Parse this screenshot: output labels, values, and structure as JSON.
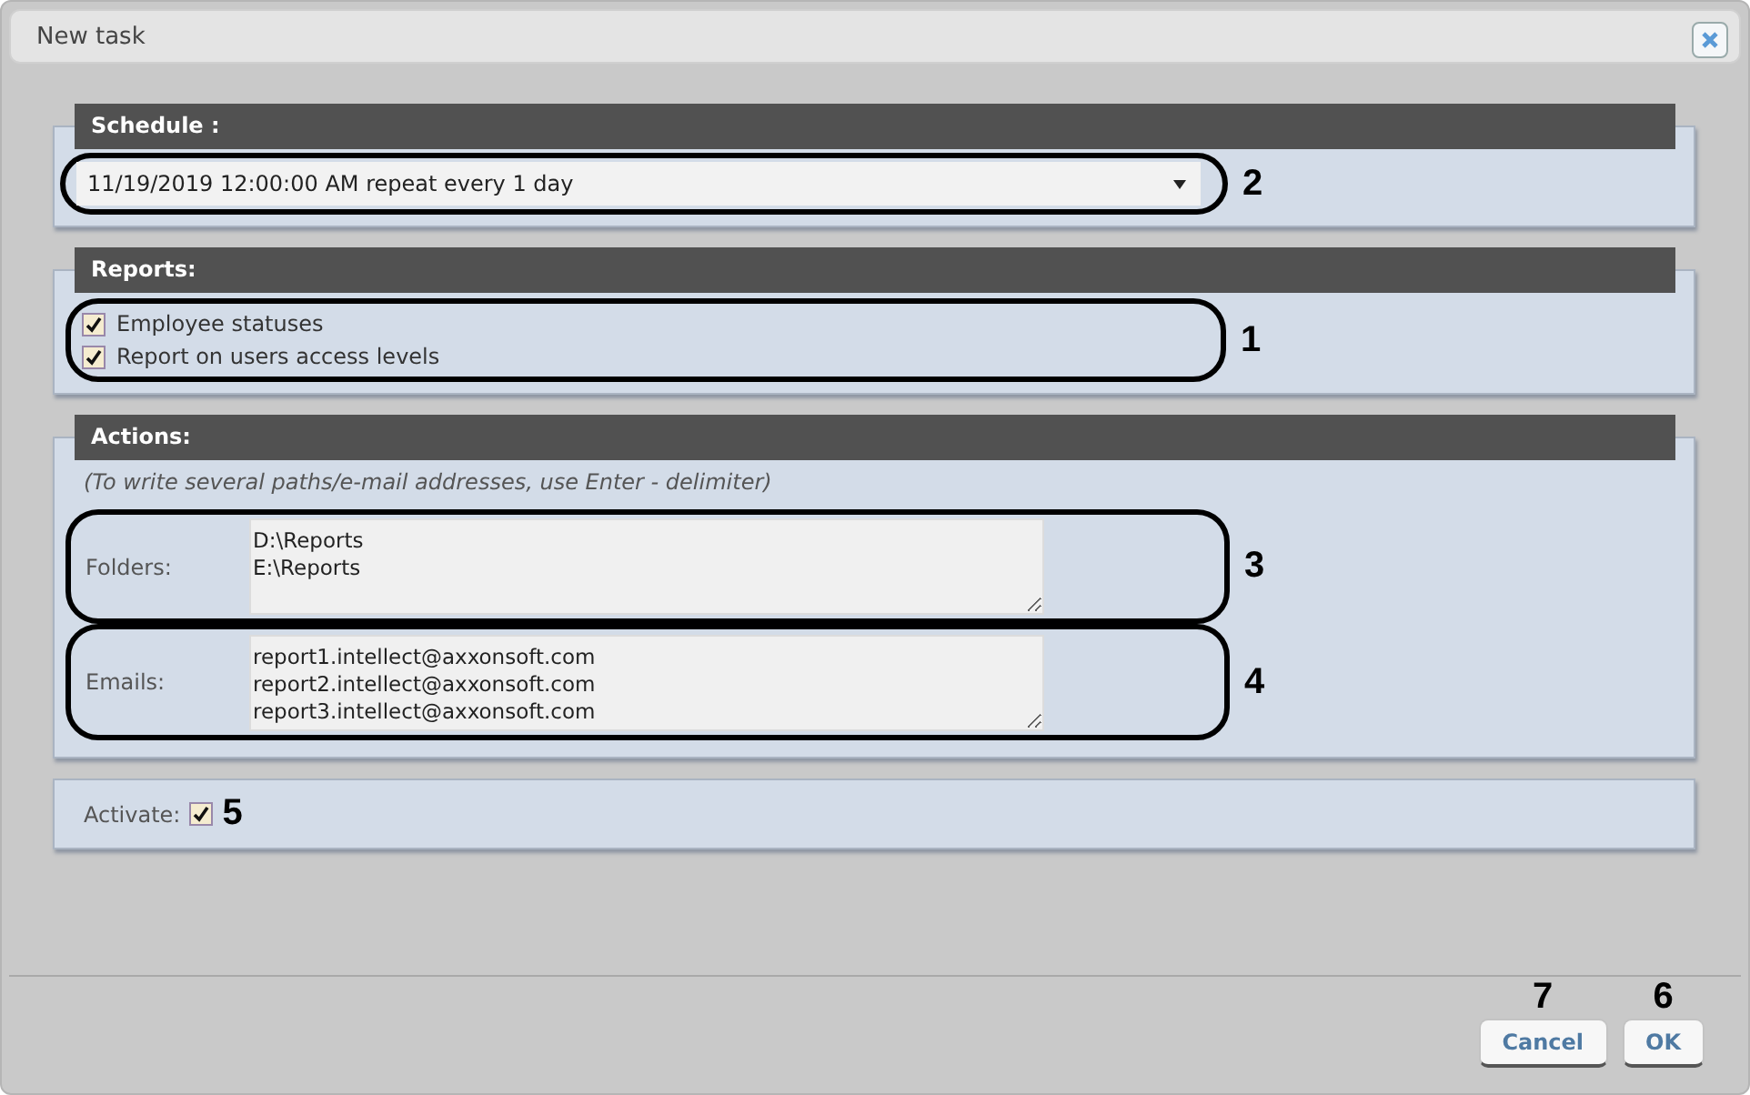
{
  "window": {
    "title": "New task"
  },
  "schedule": {
    "title": "Schedule :",
    "value": "11/19/2019 12:00:00 AM repeat every 1 day",
    "callout": "2"
  },
  "reports": {
    "title": "Reports:",
    "callout": "1",
    "items": [
      {
        "label": "Employee statuses",
        "checked": true
      },
      {
        "label": "Report on users access levels",
        "checked": true
      }
    ]
  },
  "actions": {
    "title": "Actions:",
    "hint": "(To write several paths/e-mail addresses, use Enter - delimiter)",
    "fields": [
      {
        "label": "Folders:",
        "lines": [
          "D:\\Reports",
          "E:\\Reports"
        ],
        "callout": "3"
      },
      {
        "label": "Emails:",
        "lines": [
          "report1.intellect@axxonsoft.com",
          "report2.intellect@axxonsoft.com",
          "report3.intellect@axxonsoft.com"
        ],
        "callout": "4"
      }
    ]
  },
  "activate": {
    "label": "Activate:",
    "checked": true,
    "callout": "5"
  },
  "buttons": [
    {
      "label": "Cancel",
      "callout": "7"
    },
    {
      "label": "OK",
      "callout": "6"
    }
  ]
}
